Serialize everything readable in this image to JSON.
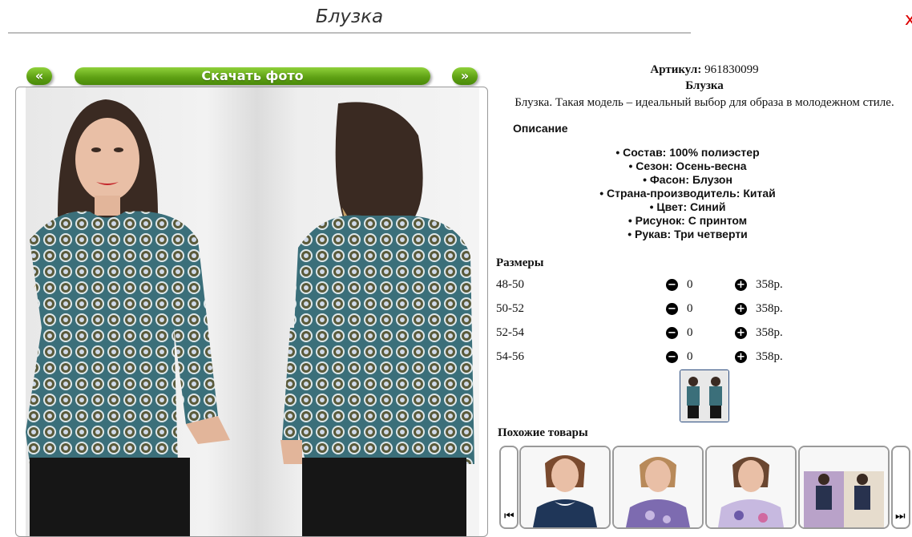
{
  "header": {
    "title": "Блузка",
    "close_glyph": "х"
  },
  "gallery": {
    "prev_label": "«",
    "next_label": "»",
    "download_label": "Скачать фото"
  },
  "product": {
    "article_label": "Артикул:",
    "article_value": "961830099",
    "name": "Блузка",
    "description": "Блузка. Такая модель – идеальный выбор для образа в молодежном стиле.",
    "description_heading": "Описание",
    "attributes": [
      "Состав: 100% полиэстер",
      "Сезон: Осень-весна",
      "Фасон: Блузон",
      "Страна-производитель: Китай",
      "Цвет: Синий",
      "Рисунок: С принтом",
      "Рукав: Три четверти"
    ]
  },
  "sizes": {
    "heading": "Размеры",
    "minus_glyph": "−",
    "plus_glyph": "+",
    "rows": [
      {
        "label": "48-50",
        "qty": "0",
        "price": "358р."
      },
      {
        "label": "50-52",
        "qty": "0",
        "price": "358р."
      },
      {
        "label": "52-54",
        "qty": "0",
        "price": "358р."
      },
      {
        "label": "54-56",
        "qty": "0",
        "price": "358р."
      }
    ]
  },
  "similar": {
    "heading": "Похожие товары",
    "prev_glyph": "⏮",
    "next_glyph": "⏭"
  },
  "colors": {
    "button_green": "#5c9e12",
    "blouse_blue": "#3b6f7a",
    "thumb_border": "#2b4c7e"
  }
}
